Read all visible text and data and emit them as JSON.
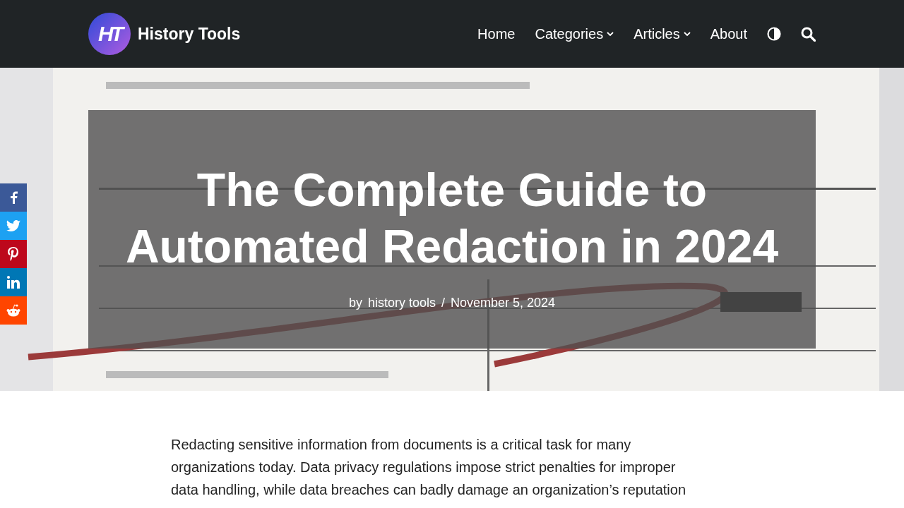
{
  "header": {
    "logo_letters": "HT",
    "site_title": "History Tools",
    "nav": [
      {
        "label": "Home",
        "dropdown": false
      },
      {
        "label": "Categories",
        "dropdown": true
      },
      {
        "label": "Articles",
        "dropdown": true
      },
      {
        "label": "About",
        "dropdown": false
      }
    ]
  },
  "share_bar": [
    {
      "kind": "facebook",
      "color": "#3b5998"
    },
    {
      "kind": "twitter",
      "color": "#1da1f2"
    },
    {
      "kind": "pinterest",
      "color": "#bd081c"
    },
    {
      "kind": "linkedin",
      "color": "#0077b5"
    },
    {
      "kind": "reddit",
      "color": "#ff4500"
    }
  ],
  "hero": {
    "title": "The Complete Guide to Automated Redaction in 2024",
    "by": "by",
    "author": "history tools",
    "separator": "/",
    "date": "November 5, 2024"
  },
  "body": {
    "paragraph": "Redacting sensitive information from documents is a critical task for many organizations today. Data privacy regulations impose strict penalties for improper data handling, while data breaches can badly damage an organization’s reputation"
  }
}
